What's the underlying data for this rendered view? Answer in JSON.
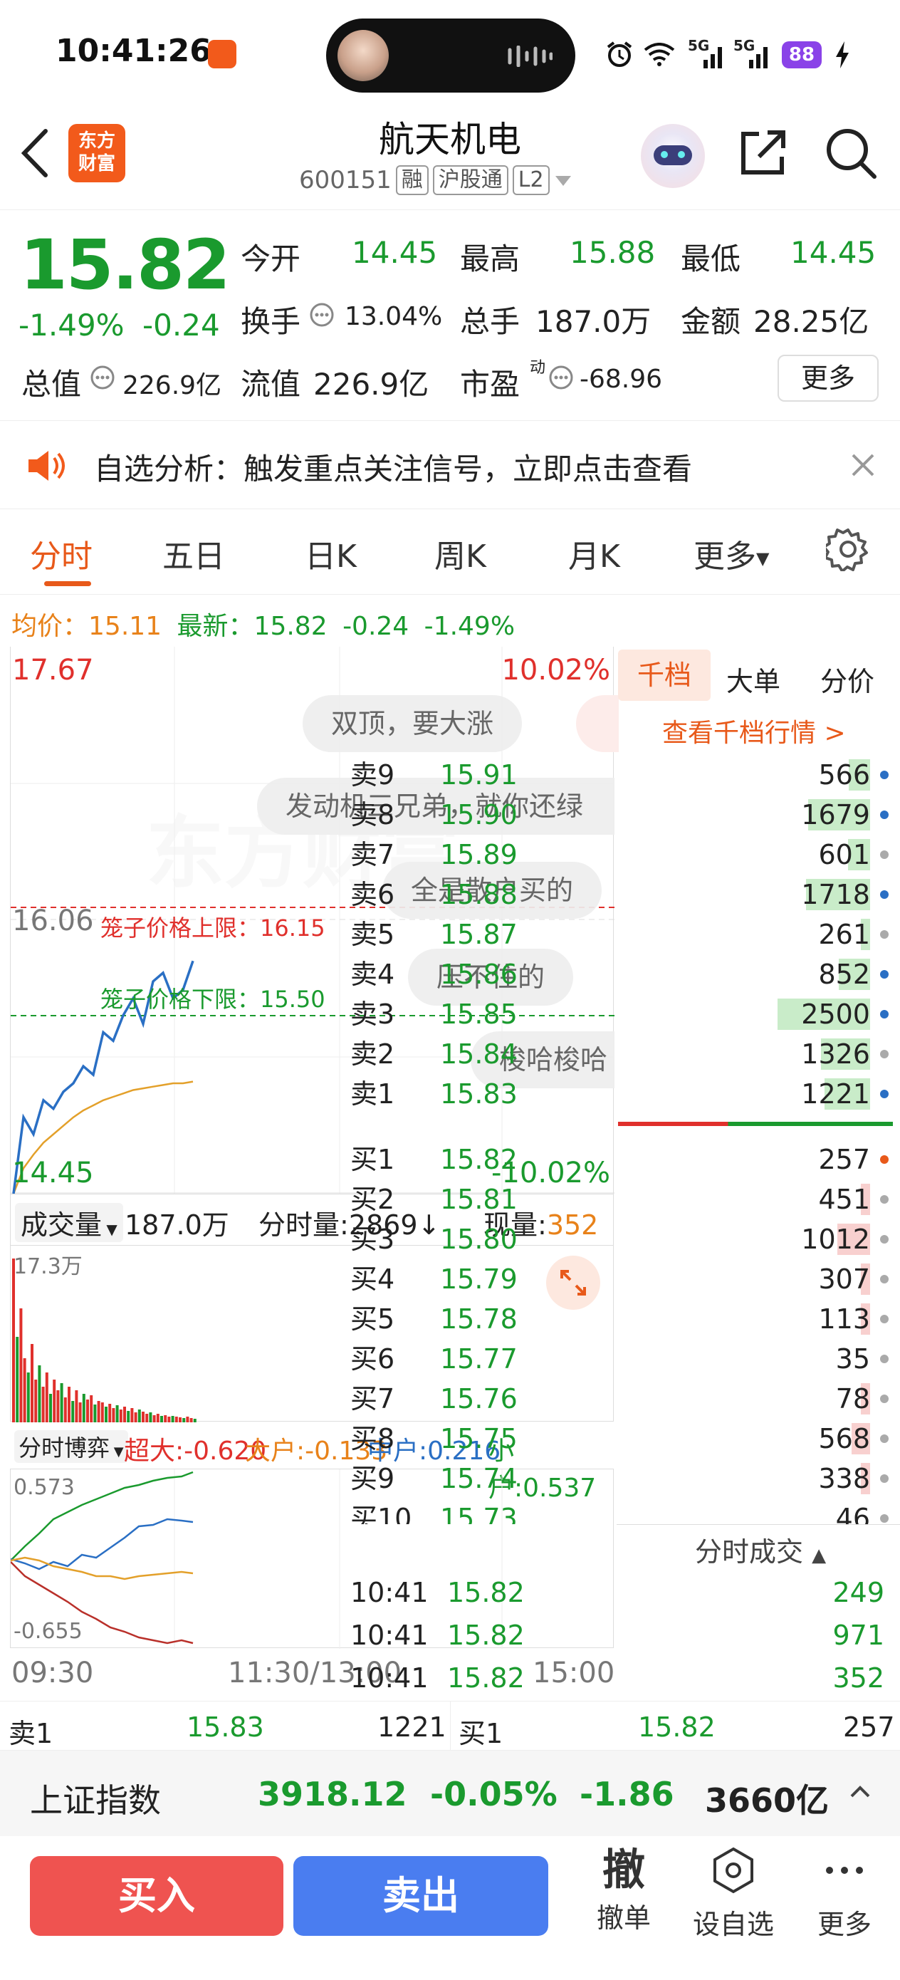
{
  "status_bar": {
    "time": "10:41:26",
    "battery": "88",
    "net1": "5G",
    "net2": "5G"
  },
  "header": {
    "logo_line1": "东方",
    "logo_line2": "财富",
    "stock_name": "航天机电",
    "stock_code": "600151",
    "tags": [
      "融",
      "沪股通",
      "L2"
    ]
  },
  "quote": {
    "price": "15.82",
    "change_pct": "-1.49%",
    "change": "-0.24",
    "open_label": "今开",
    "open": "14.45",
    "high_label": "最高",
    "high": "15.88",
    "low_label": "最低",
    "low": "14.45",
    "turnover_label": "换手",
    "turnover": "13.04%",
    "volume_label": "总手",
    "volume": "187.0万",
    "amount_label": "金额",
    "amount": "28.25亿",
    "mktcap_label": "总值",
    "mktcap": "226.9亿",
    "float_label": "流值",
    "float": "226.9亿",
    "pe_label": "市盈",
    "pe_sup": "动",
    "pe": "-68.96",
    "more": "更多"
  },
  "banner": {
    "text": "自选分析：触发重点关注信号，立即点击查看"
  },
  "tabs": [
    "分时",
    "五日",
    "日K",
    "周K",
    "月K",
    "更多"
  ],
  "avg_line": {
    "avg_label": "均价：",
    "avg": "15.11",
    "last_label": "最新：",
    "last": "15.82",
    "chg": "-0.24",
    "pct": "-1.49%"
  },
  "chart": {
    "y_top": "17.67",
    "y_top_pct": "10.02%",
    "y_mid": "16.06",
    "y_bot": "14.45",
    "y_bot_pct": "-10.02%",
    "cage_upper": "笼子价格上限：16.15",
    "cage_lower": "笼子价格下限：15.50",
    "watermark": "东方财富",
    "comments": [
      "双顶，要大涨",
      "发动机三兄弟，就你还绿",
      "全是散户买的",
      "压不住的",
      "梭哈梭哈"
    ],
    "vol_selector": "成交量",
    "vol_total": "187.0万",
    "vol_min_label": "分时量:",
    "vol_min": "2869",
    "vol_now_label": "现量:",
    "vol_now": "352",
    "vol_max": "17.3万",
    "game_selector": "分时博弈",
    "super_label": "超大:",
    "super": "-0.620",
    "big_label": "大户:",
    "big": "-0.133",
    "mid_label": "中户:",
    "mid": "0.216",
    "small_label": "小户:",
    "small": "0.537",
    "game_top": "0.573",
    "game_bot": "-0.655",
    "t_start": "09:30",
    "t_mid": "11:30/13:00",
    "t_end": "15:00"
  },
  "chart_data": {
    "type": "line",
    "series": [
      {
        "name": "最新",
        "values": [
          14.45,
          14.9,
          14.8,
          15.0,
          14.95,
          15.05,
          15.1,
          15.2,
          15.15,
          15.4,
          15.35,
          15.5,
          15.6,
          15.45,
          15.7,
          15.75,
          15.6,
          15.65,
          15.82
        ]
      },
      {
        "name": "均价",
        "values": [
          14.45,
          14.6,
          14.68,
          14.75,
          14.8,
          14.85,
          14.9,
          14.94,
          14.97,
          15.0,
          15.02,
          15.04,
          15.06,
          15.07,
          15.08,
          15.09,
          15.1,
          15.1,
          15.11
        ]
      }
    ],
    "ylim": [
      14.45,
      17.67
    ]
  },
  "order_book": {
    "tabs": [
      "千档",
      "大单",
      "分价"
    ],
    "link": "查看千档行情 >",
    "asks": [
      {
        "label": "卖9",
        "price": "15.91",
        "vol": "566",
        "bar": 0.23
      },
      {
        "label": "卖8",
        "price": "15.90",
        "vol": "1679",
        "bar": 0.67
      },
      {
        "label": "卖7",
        "price": "15.89",
        "vol": "601",
        "bar": 0.24
      },
      {
        "label": "卖6",
        "price": "15.88",
        "vol": "1718",
        "bar": 0.69
      },
      {
        "label": "卖5",
        "price": "15.87",
        "vol": "261",
        "bar": 0.1
      },
      {
        "label": "卖4",
        "price": "15.86",
        "vol": "852",
        "bar": 0.34
      },
      {
        "label": "卖3",
        "price": "15.85",
        "vol": "2500",
        "bar": 1.0
      },
      {
        "label": "卖2",
        "price": "15.84",
        "vol": "1326",
        "bar": 0.53
      },
      {
        "label": "卖1",
        "price": "15.83",
        "vol": "1221",
        "bar": 0.49
      }
    ],
    "bids": [
      {
        "label": "买1",
        "price": "15.82",
        "vol": "257",
        "bar": 0.0
      },
      {
        "label": "买2",
        "price": "15.81",
        "vol": "451",
        "bar": 0.1
      },
      {
        "label": "买3",
        "price": "15.80",
        "vol": "1012",
        "bar": 0.35
      },
      {
        "label": "买4",
        "price": "15.79",
        "vol": "307",
        "bar": 0.1
      },
      {
        "label": "买5",
        "price": "15.78",
        "vol": "113",
        "bar": 0.1
      },
      {
        "label": "买6",
        "price": "15.77",
        "vol": "35",
        "bar": 0.0
      },
      {
        "label": "买7",
        "price": "15.76",
        "vol": "78",
        "bar": 0.1
      },
      {
        "label": "买8",
        "price": "15.75",
        "vol": "568",
        "bar": 0.2
      },
      {
        "label": "买9",
        "price": "15.74",
        "vol": "338",
        "bar": 0.1
      },
      {
        "label": "买10",
        "price": "15.73",
        "vol": "46",
        "bar": 0.0
      }
    ],
    "trades_title": "分时成交",
    "trades": [
      {
        "time": "10:41",
        "price": "15.82",
        "vol": "249"
      },
      {
        "time": "10:41",
        "price": "15.82",
        "vol": "971"
      },
      {
        "time": "10:41",
        "price": "15.82",
        "vol": "352"
      }
    ]
  },
  "bottom_quote": {
    "ask_label": "卖1",
    "ask_price": "15.83",
    "ask_vol": "1221",
    "bid_label": "买1",
    "bid_price": "15.82",
    "bid_vol": "257"
  },
  "index_bar": {
    "name": "上证指数",
    "value": "3918.12",
    "pct": "-0.05%",
    "chg": "-1.86",
    "amount": "3660亿"
  },
  "actions": {
    "buy": "买入",
    "sell": "卖出",
    "cancel_glyph": "撤",
    "cancel": "撤单",
    "watch": "设自选",
    "more": "更多"
  },
  "colors": {
    "up": "#e0302c",
    "down": "#1a9a2e",
    "accent": "#e8591a",
    "buy_btn": "#ef5350",
    "sell_btn": "#4a7df0"
  }
}
